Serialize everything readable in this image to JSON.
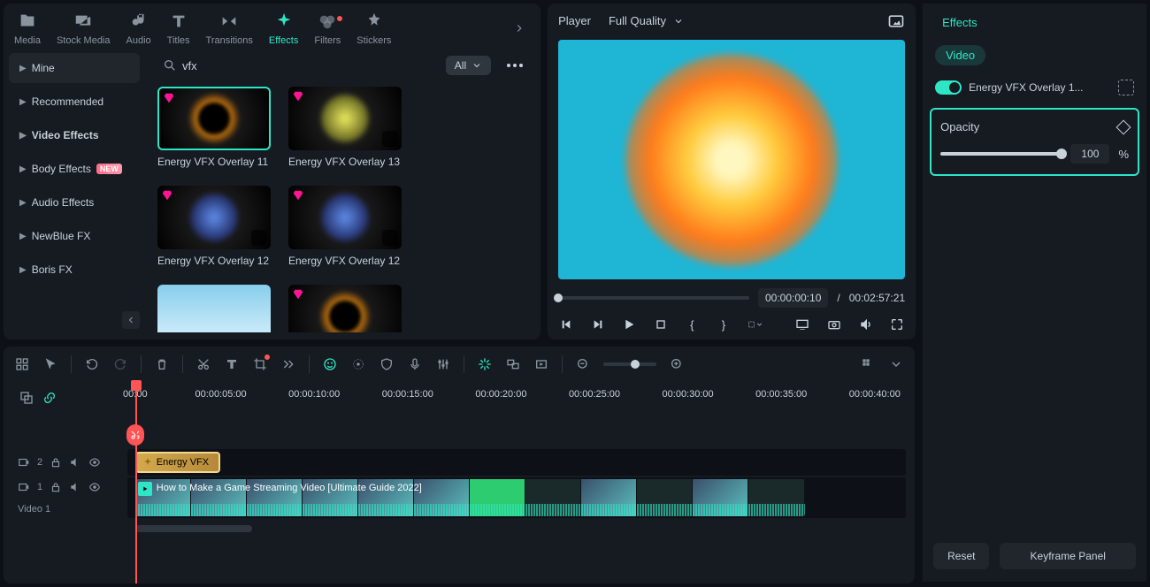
{
  "tabs": [
    {
      "label": "Media"
    },
    {
      "label": "Stock Media"
    },
    {
      "label": "Audio"
    },
    {
      "label": "Titles"
    },
    {
      "label": "Transitions"
    },
    {
      "label": "Effects",
      "active": true
    },
    {
      "label": "Filters",
      "has_dot": true
    },
    {
      "label": "Stickers"
    }
  ],
  "sidebar": {
    "items": [
      {
        "label": "Mine",
        "dark": true
      },
      {
        "label": "Recommended"
      },
      {
        "label": "Video Effects",
        "active": true
      },
      {
        "label": "Body Effects",
        "badge": "NEW"
      },
      {
        "label": "Audio Effects"
      },
      {
        "label": "NewBlue FX"
      },
      {
        "label": "Boris FX"
      }
    ]
  },
  "search": {
    "placeholder": "",
    "value": "vfx"
  },
  "filter": {
    "label": "All"
  },
  "cards": [
    {
      "title": "Energy VFX Overlay 11",
      "variant": "orange",
      "gem": true,
      "selected": true,
      "download": false
    },
    {
      "title": "Energy VFX Overlay 13",
      "variant": "yellow",
      "gem": true,
      "download": true
    },
    {
      "title": "Energy VFX Overlay 12",
      "variant": "blue",
      "gem": true,
      "download": true
    },
    {
      "title": "Energy VFX Overlay 12",
      "variant": "blue",
      "gem": true,
      "download": true
    },
    {
      "title": "",
      "variant": "sky",
      "gem": false,
      "download": false
    },
    {
      "title": "",
      "variant": "orange",
      "gem": true,
      "download": false
    }
  ],
  "player": {
    "label": "Player",
    "quality": "Full Quality",
    "current_time": "00:00:00:10",
    "separator": "/",
    "total_time": "00:02:57:21"
  },
  "inspector": {
    "tab": "Effects",
    "pill": "Video",
    "effect_name": "Energy VFX Overlay 1...",
    "opacity_label": "Opacity",
    "opacity_value": "100",
    "opacity_unit": "%",
    "reset": "Reset",
    "keyframe": "Keyframe Panel"
  },
  "timeline": {
    "ticks": [
      "00:00",
      "00:00:05:00",
      "00:00:10:00",
      "00:00:15:00",
      "00:00:20:00",
      "00:00:25:00",
      "00:00:30:00",
      "00:00:35:00",
      "00:00:40:00"
    ],
    "vfx_clip": "Energy VFX",
    "video_clip": "How to Make a Game Streaming Video [Ultimate Guide 2022]",
    "track2_num": "2",
    "track1_num": "1",
    "track1_label": "Video 1"
  }
}
